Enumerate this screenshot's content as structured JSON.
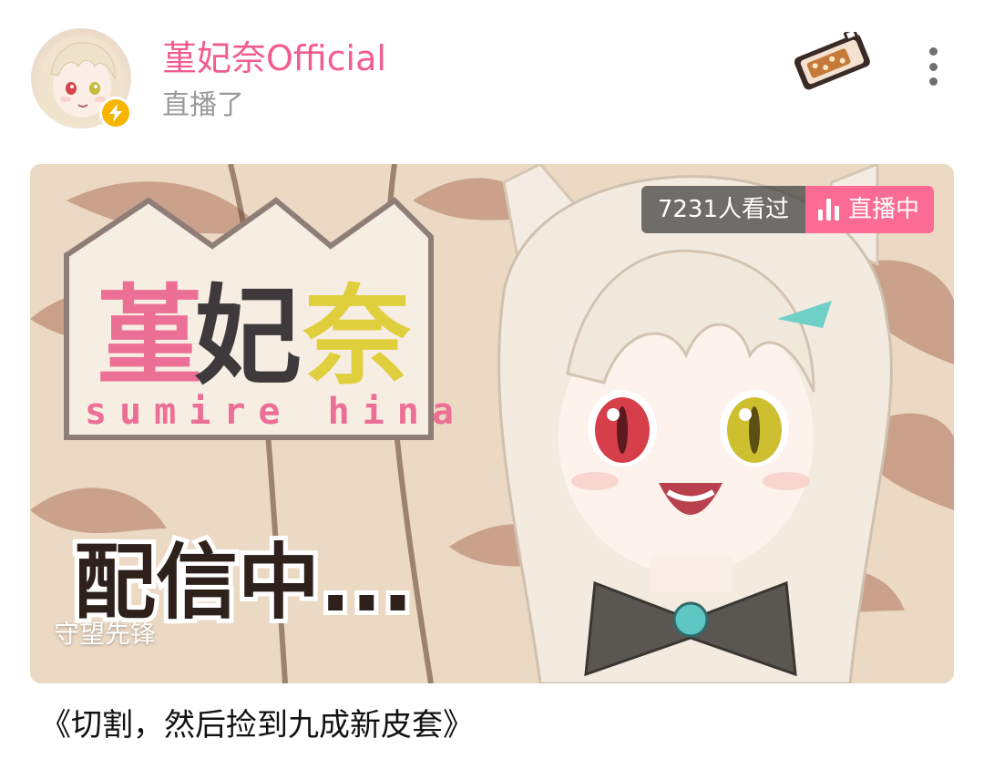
{
  "header": {
    "user_name": "堇妃奈Official",
    "action": "直播了",
    "avatar_icon": "avatar-anime-girl",
    "verified_icon": "lightning-bolt-icon",
    "decoration_icon": "pixel-bread-tray-icon",
    "more_icon": "more-vertical-icon"
  },
  "cover": {
    "logo_title": "堇妃奈",
    "logo_subtitle": "sumire hina",
    "caption": "配信中...",
    "view_count": "7231人看过",
    "live_label": "直播中",
    "live_icon": "signal-bars-icon",
    "category": "守望先锋"
  },
  "stream": {
    "title": "《切割，然后捡到九成新皮套》"
  },
  "colors": {
    "name_pink": "#f25d8e",
    "live_pink": "#fb6b93",
    "badge_yellow": "#f7b500",
    "gray_text": "#9a9a9a"
  }
}
